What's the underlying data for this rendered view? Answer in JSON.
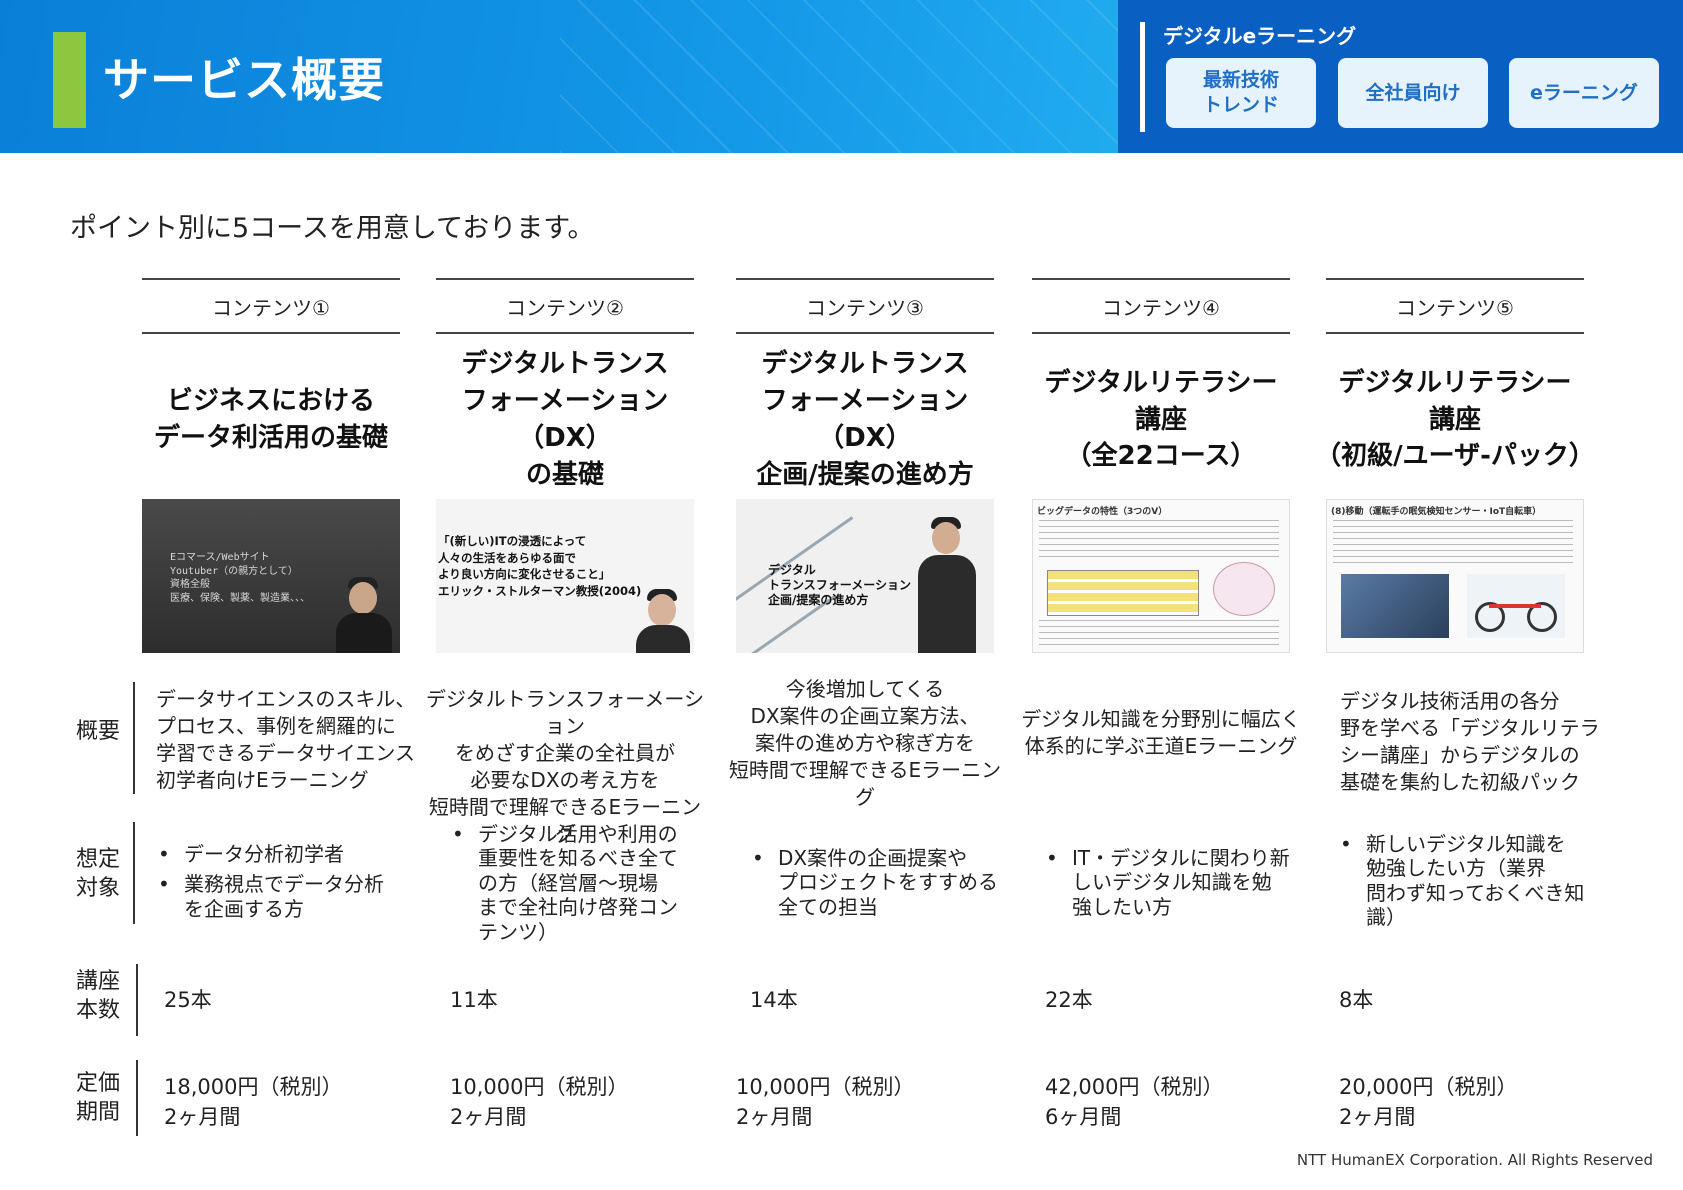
{
  "header": {
    "title": "サービス概要",
    "panel_title": "デジタルeラーニング",
    "tags": [
      "最新技術\nトレンド",
      "全社員向け",
      "eラーニング"
    ]
  },
  "intro": "ポイント別に5コースを用意しております。",
  "row_labels": {
    "summary": "概要",
    "target": "想定\n対象",
    "count": "講座\n本数",
    "price": "定価\n期間"
  },
  "courses": [
    {
      "label": "コンテンツ①",
      "title": "ビジネスにおける\nデータ利活用の基礎",
      "thumb_text": "Eコマース/Webサイト\nYoutuber（の親方として）\n資格全般\n医療、保険、製薬、製造業、、、",
      "summary": "データサイエンスのスキル、\nプロセス、事例を網羅的に\n学習できるデータサイエンス\n初学者向けEラーニング",
      "targets": [
        "データ分析初学者",
        "業務視点でデータ分析\nを企画する方"
      ],
      "count": "25本",
      "price": "18,000円（税別）",
      "period": "2ヶ月間"
    },
    {
      "label": "コンテンツ②",
      "title": "デジタルトランス\nフォーメーション（DX）\nの基礎",
      "thumb_text": "「(新しい)ITの浸透によって\n人々の生活をあらゆる面で\nより良い方向に変化させること」\nエリック・ストルターマン教授(2004)",
      "summary": "デジタルトランスフォーメーション\nをめざす企業の全社員が\n必要なDXの考え方を\n短時間で理解できるEラーニング",
      "targets": [
        "デジタル活用や利用の\n重要性を知るべき全て\nの方（経営層～現場\nまで全社向け啓発コン\nテンツ）"
      ],
      "count": "11本",
      "price": "10,000円（税別）",
      "period": "2ヶ月間"
    },
    {
      "label": "コンテンツ③",
      "title": "デジタルトランス\nフォーメーション（DX）\n企画/提案の進め方",
      "thumb_text": "デジタル\nトランスフォーメーション\n企画/提案の進め方",
      "summary": "今後増加してくる\nDX案件の企画立案方法、\n案件の進め方や稼ぎ方を\n短時間で理解できるEラーニング",
      "targets": [
        "DX案件の企画提案や\nプロジェクトをすすめる\n全ての担当"
      ],
      "count": "14本",
      "price": "10,000円（税別）",
      "period": "2ヶ月間"
    },
    {
      "label": "コンテンツ④",
      "title": "デジタルリテラシー\n講座\n（全22コース）",
      "thumb_text": "ビッグデータの特性（3つのV）",
      "summary": "デジタル知識を分野別に幅広く\n体系的に学ぶ王道Eラーニング",
      "targets": [
        "IT・デジタルに関わり新\nしいデジタル知識を勉\n強したい方"
      ],
      "count": "22本",
      "price": "42,000円（税別）",
      "period": "6ヶ月間"
    },
    {
      "label": "コンテンツ⑤",
      "title": "デジタルリテラシー\n講座\n（初級/ユーザ-パック）",
      "thumb_text": "(8)移動（運転手の眠気検知センサー・IoT自転車）",
      "summary": "デジタル技術活用の各分\n野を学べる「デジタルリテラ\nシー講座」からデジタルの\n基礎を集約した初級パック",
      "targets": [
        "新しいデジタル知識を\n勉強したい方（業界\n問わず知っておくべき知\n識）"
      ],
      "count": "8本",
      "price": "20,000円（税別）",
      "period": "2ヶ月間"
    }
  ],
  "footer": "NTT HumanEX Corporation. All Rights Reserved"
}
